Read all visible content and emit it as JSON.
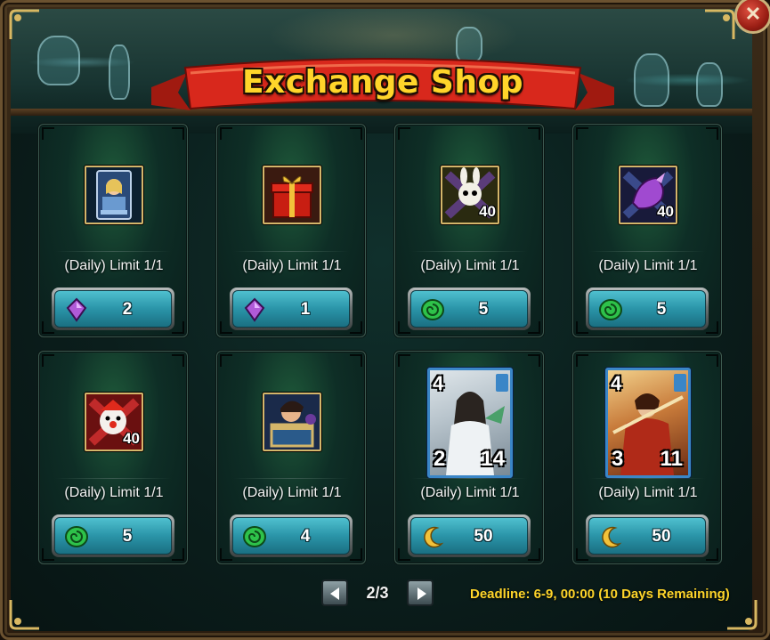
{
  "window": {
    "title": "Exchange Shop",
    "close_glyph": "✕"
  },
  "items": [
    {
      "limit": "(Daily) Limit 1/1",
      "icon": "hero-card-pack-icon",
      "qty": "",
      "currency": "purple-crystal-icon",
      "price": "2"
    },
    {
      "limit": "(Daily) Limit 1/1",
      "icon": "red-gift-box-icon",
      "qty": "",
      "currency": "purple-crystal-icon",
      "price": "1"
    },
    {
      "limit": "(Daily) Limit 1/1",
      "icon": "rabbit-skull-shard-icon",
      "qty": "40",
      "currency": "green-swirl-coin-icon",
      "price": "5"
    },
    {
      "limit": "(Daily) Limit 1/1",
      "icon": "purple-dragon-shard-icon",
      "qty": "40",
      "currency": "green-swirl-coin-icon",
      "price": "5"
    },
    {
      "limit": "(Daily) Limit 1/1",
      "icon": "clown-mask-shard-icon",
      "qty": "40",
      "currency": "green-swirl-coin-icon",
      "price": "5"
    },
    {
      "limit": "(Daily) Limit 1/1",
      "icon": "treasure-chest-warrior-icon",
      "qty": "",
      "currency": "green-swirl-coin-icon",
      "price": "4"
    },
    {
      "limit": "(Daily) Limit 1/1",
      "icon": "hero-card-sorceress",
      "qty": "",
      "currency": "gold-crescent-moon-icon",
      "price": "50",
      "hero": {
        "level": "4",
        "attack": "2",
        "health": "14"
      }
    },
    {
      "limit": "(Daily) Limit 1/1",
      "icon": "hero-card-warrior",
      "qty": "",
      "currency": "gold-crescent-moon-icon",
      "price": "50",
      "hero": {
        "level": "4",
        "attack": "3",
        "health": "11"
      }
    }
  ],
  "pager": {
    "page_label": "2/3",
    "prev_icon": "arrow-left-icon",
    "next_icon": "arrow-right-icon"
  },
  "deadline": "Deadline: 6-9, 00:00 (10 Days Remaining)",
  "colors": {
    "title": "#ffd52a",
    "deadline": "#ffd52a",
    "button_face": "#2a94a8",
    "ribbon": "#d8281c"
  }
}
